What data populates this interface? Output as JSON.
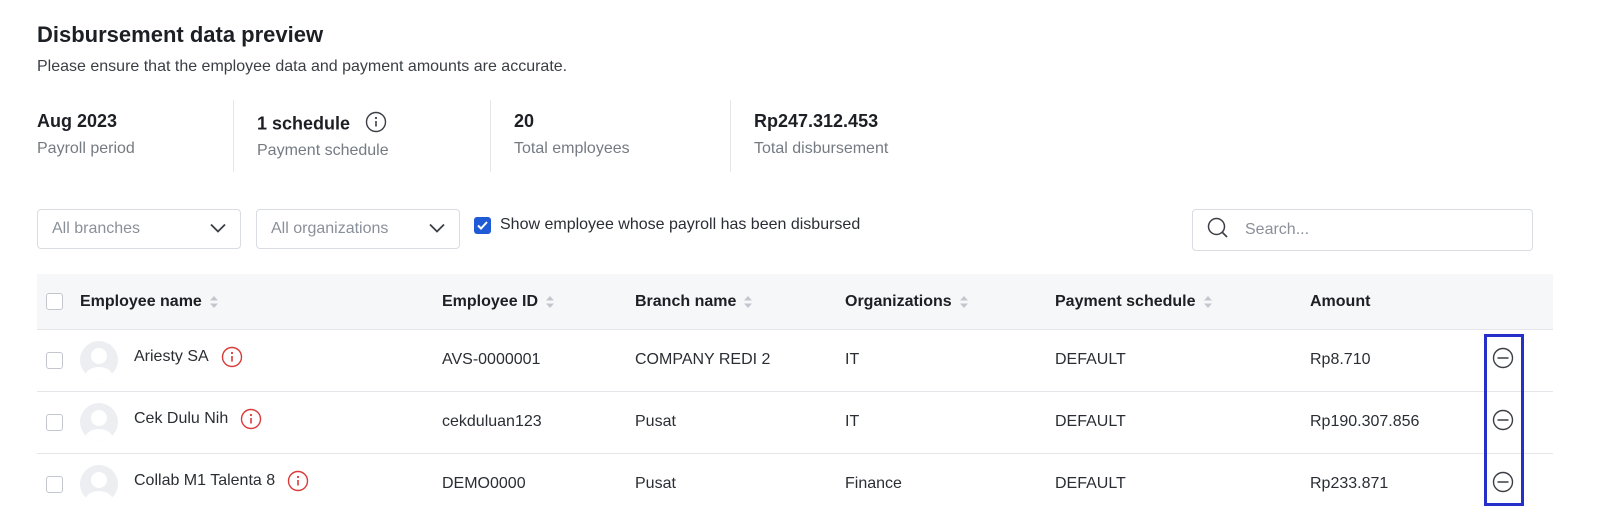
{
  "header": {
    "title": "Disbursement data preview",
    "subtitle": "Please ensure that the employee data and payment amounts are accurate."
  },
  "summary": [
    {
      "value": "Aug 2023",
      "label": "Payroll period"
    },
    {
      "value": "1 schedule",
      "label": "Payment schedule"
    },
    {
      "value": "20",
      "label": "Total employees"
    },
    {
      "value": "Rp247.312.453",
      "label": "Total disbursement"
    }
  ],
  "filters": {
    "branches": "All branches",
    "organizations": "All organizations",
    "show_disbursed_label": "Show employee whose payroll has been disbursed",
    "search_placeholder": "Search..."
  },
  "table": {
    "columns": {
      "name": "Employee name",
      "id": "Employee ID",
      "branch": "Branch name",
      "org": "Organizations",
      "schedule": "Payment schedule",
      "amount": "Amount"
    },
    "rows": [
      {
        "name": "Ariesty SA",
        "id": "AVS-0000001",
        "branch": "COMPANY REDI 2",
        "org": "IT",
        "schedule": "DEFAULT",
        "amount": "Rp8.710"
      },
      {
        "name": "Cek Dulu Nih",
        "id": "cekduluan123",
        "branch": "Pusat",
        "org": "IT",
        "schedule": "DEFAULT",
        "amount": "Rp190.307.856"
      },
      {
        "name": "Collab M1 Talenta 8",
        "id": "DEMO0000",
        "branch": "Pusat",
        "org": "Finance",
        "schedule": "DEFAULT",
        "amount": "Rp233.871"
      }
    ]
  },
  "colors": {
    "accent": "#1f5bd6",
    "warning": "#d93a3a",
    "highlight": "#2430c8"
  }
}
